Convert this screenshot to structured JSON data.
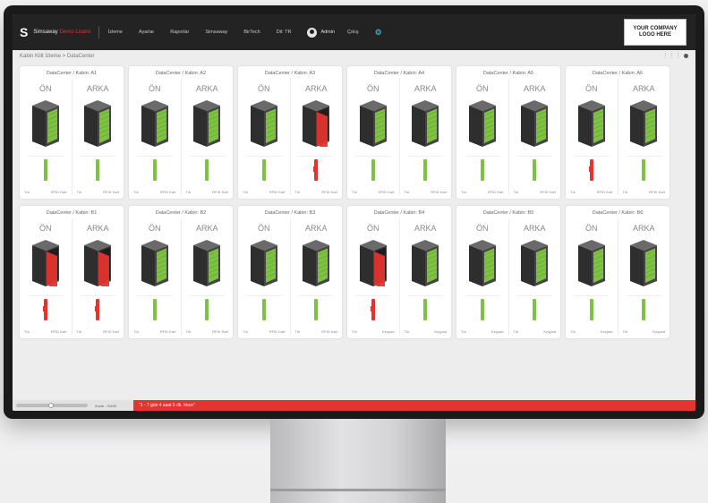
{
  "navbar": {
    "brand_logo": "S",
    "brand_name": "Simsaway",
    "brand_sub": "Demo Lisans",
    "items": [
      "İzleme",
      "Ayarlar",
      "Raporlar",
      "Simsaway",
      "BirTech",
      "Dil: TR"
    ],
    "user": "Admin",
    "logout": "Çıkış",
    "company_logo_line1": "YOUR COMPANY",
    "company_logo_line2": "LOGO HERE",
    "icons": {
      "settings": "gear-icon",
      "user": "user-icon"
    }
  },
  "breadcrumb": "Kabin Kilit İzleme > DataCenter",
  "view_toggle": "⋮⋮⋮",
  "labels": {
    "front": "ÖN",
    "back": "ARKA"
  },
  "colors": {
    "ok": "#7ec242",
    "alarm": "#e3342f",
    "rack": "#3a3a3a"
  },
  "cabinets": [
    {
      "title": "DataCenter / Kabin: A1",
      "front": {
        "door": "closed",
        "lock": "ok",
        "status": "Tür",
        "source": "RFID Kart"
      },
      "back": {
        "door": "closed",
        "lock": "ok",
        "status": "Tür",
        "source": "RFID Kart"
      }
    },
    {
      "title": "DataCenter / Kabin: A2",
      "front": {
        "door": "closed",
        "lock": "ok",
        "status": "Tür",
        "source": "RFID Kart"
      },
      "back": {
        "door": "closed",
        "lock": "ok",
        "status": "Tür",
        "source": "RFID Kart"
      }
    },
    {
      "title": "DataCenter / Kabin: A3",
      "front": {
        "door": "closed",
        "lock": "ok",
        "status": "Tür",
        "source": "RFID Kart"
      },
      "back": {
        "door": "open",
        "lock": "alarm",
        "status": "Tür",
        "source": "RFID Kart"
      }
    },
    {
      "title": "DataCenter / Kabin: A4",
      "front": {
        "door": "closed",
        "lock": "ok",
        "status": "Tür",
        "source": "RFID Kart"
      },
      "back": {
        "door": "closed",
        "lock": "ok",
        "status": "Tür",
        "source": "RFID Kart"
      }
    },
    {
      "title": "DataCenter / Kabin: A5",
      "front": {
        "door": "closed",
        "lock": "ok",
        "status": "Tür",
        "source": "RFID Kart"
      },
      "back": {
        "door": "closed",
        "lock": "ok",
        "status": "Tür",
        "source": "RFID Kart"
      }
    },
    {
      "title": "DataCenter / Kabin: A6",
      "front": {
        "door": "closed",
        "lock": "alarm",
        "status": "Tür",
        "source": "RFID Kart"
      },
      "back": {
        "door": "closed",
        "lock": "ok",
        "status": "Tür",
        "source": "RFID Kart"
      }
    },
    {
      "title": "DataCenter / Kabin: B1",
      "front": {
        "door": "open",
        "lock": "alarm",
        "status": "Tür",
        "source": "RFID Kart"
      },
      "back": {
        "door": "open",
        "lock": "alarm",
        "status": "Tür",
        "source": "RFID Kart"
      }
    },
    {
      "title": "DataCenter / Kabin: B2",
      "front": {
        "door": "closed",
        "lock": "ok",
        "status": "Tür",
        "source": "RFID Kart"
      },
      "back": {
        "door": "closed",
        "lock": "ok",
        "status": "Tür",
        "source": "RFID Kart"
      }
    },
    {
      "title": "DataCenter / Kabin: B3",
      "front": {
        "door": "closed",
        "lock": "ok",
        "status": "Tür",
        "source": "RFID Kart"
      },
      "back": {
        "door": "closed",
        "lock": "ok",
        "status": "Tür",
        "source": "RFID Kart"
      }
    },
    {
      "title": "DataCenter / Kabin: B4",
      "front": {
        "door": "open",
        "lock": "alarm",
        "status": "Tür",
        "source": "Keypad"
      },
      "back": {
        "door": "closed",
        "lock": "ok",
        "status": "Tür",
        "source": "Keypad"
      }
    },
    {
      "title": "DataCenter / Kabin: B5",
      "front": {
        "door": "closed",
        "lock": "ok",
        "status": "Tür",
        "source": "Keypad"
      },
      "back": {
        "door": "closed",
        "lock": "ok",
        "status": "Tür",
        "source": "Keypad"
      }
    },
    {
      "title": "DataCenter / Kabin: B6",
      "front": {
        "door": "closed",
        "lock": "ok",
        "status": "Tür",
        "source": "Keypad"
      },
      "back": {
        "door": "closed",
        "lock": "ok",
        "status": "Tür",
        "source": "Keypad"
      }
    }
  ],
  "bottom": {
    "zoom_label": "Zoom - %100",
    "alarm_text": "“1 - 7 gün 4 saat 5 dk. önce”"
  }
}
